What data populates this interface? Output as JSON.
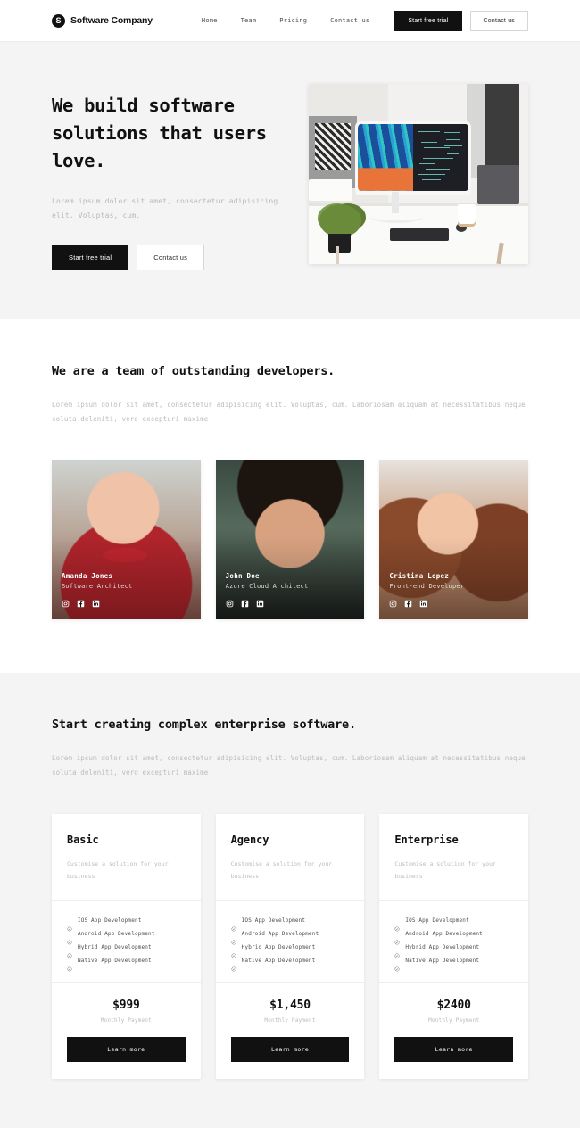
{
  "header": {
    "brand_mark": "S",
    "brand_name": "Software Company",
    "nav": [
      {
        "label": "Home"
      },
      {
        "label": "Team"
      },
      {
        "label": "Pricing"
      },
      {
        "label": "Contact us"
      }
    ],
    "primary_cta": "Start free trial",
    "secondary_cta": "Contact us"
  },
  "hero": {
    "title": "We build software solutions that users love.",
    "subtitle": "Lorem ipsum dolor sit amet, consectetur adipisicing elit. Voluptas, cum.",
    "primary_cta": "Start free trial",
    "secondary_cta": "Contact us",
    "image_alt": "desk-with-ultrawide-monitor-photo"
  },
  "team": {
    "title": "We are a team of outstanding developers.",
    "description": "Lorem ipsum dolor sit amet, consectetur adipisicing elit. Voluptas, cum. Laboriosam aliquam at necessitatibus neque soluta deleniti, vero excepturi maxime",
    "members": [
      {
        "name": "Amanda Jones",
        "role": "Software Architect"
      },
      {
        "name": "John Doe",
        "role": "Azure Cloud Architect"
      },
      {
        "name": "Cristina Lopez",
        "role": "Front-end Developer"
      }
    ],
    "social_icons": [
      "instagram-icon",
      "facebook-icon",
      "linkedin-icon"
    ]
  },
  "pricing": {
    "title": "Start creating complex enterprise software.",
    "description": "Lorem ipsum dolor sit amet, consectetur adipisicing elit. Voluptas, cum. Laboriosam aliquam at necessitatibus neque soluta deleniti, vero excepturi maxime",
    "plans": [
      {
        "name": "Basic",
        "tagline": "Customise a solution for your business",
        "features": [
          "IOS App Development",
          "Android App Development",
          "Hybrid App Development",
          "Native App Development"
        ],
        "price": "$999",
        "period": "Monthly Payment",
        "cta": "Learn more"
      },
      {
        "name": "Agency",
        "tagline": "Customise a solution for your business",
        "features": [
          "IOS App Development",
          "Android App Development",
          "Hybrid App Development",
          "Native App Development"
        ],
        "price": "$1,450",
        "period": "Monthly Payment",
        "cta": "Learn more"
      },
      {
        "name": "Enterprise",
        "tagline": "Customise a solution for your business",
        "features": [
          "IOS App Development",
          "Android App Development",
          "Hybrid App Development",
          "Native App Development"
        ],
        "price": "$2400",
        "period": "Monthly Payment",
        "cta": "Learn more"
      }
    ],
    "feature_icon": "check-circle-icon"
  },
  "colors": {
    "accent": "#111111",
    "page_bg": "#ffffff",
    "section_bg": "#f4f4f5",
    "muted_text": "#bdbdbd"
  }
}
